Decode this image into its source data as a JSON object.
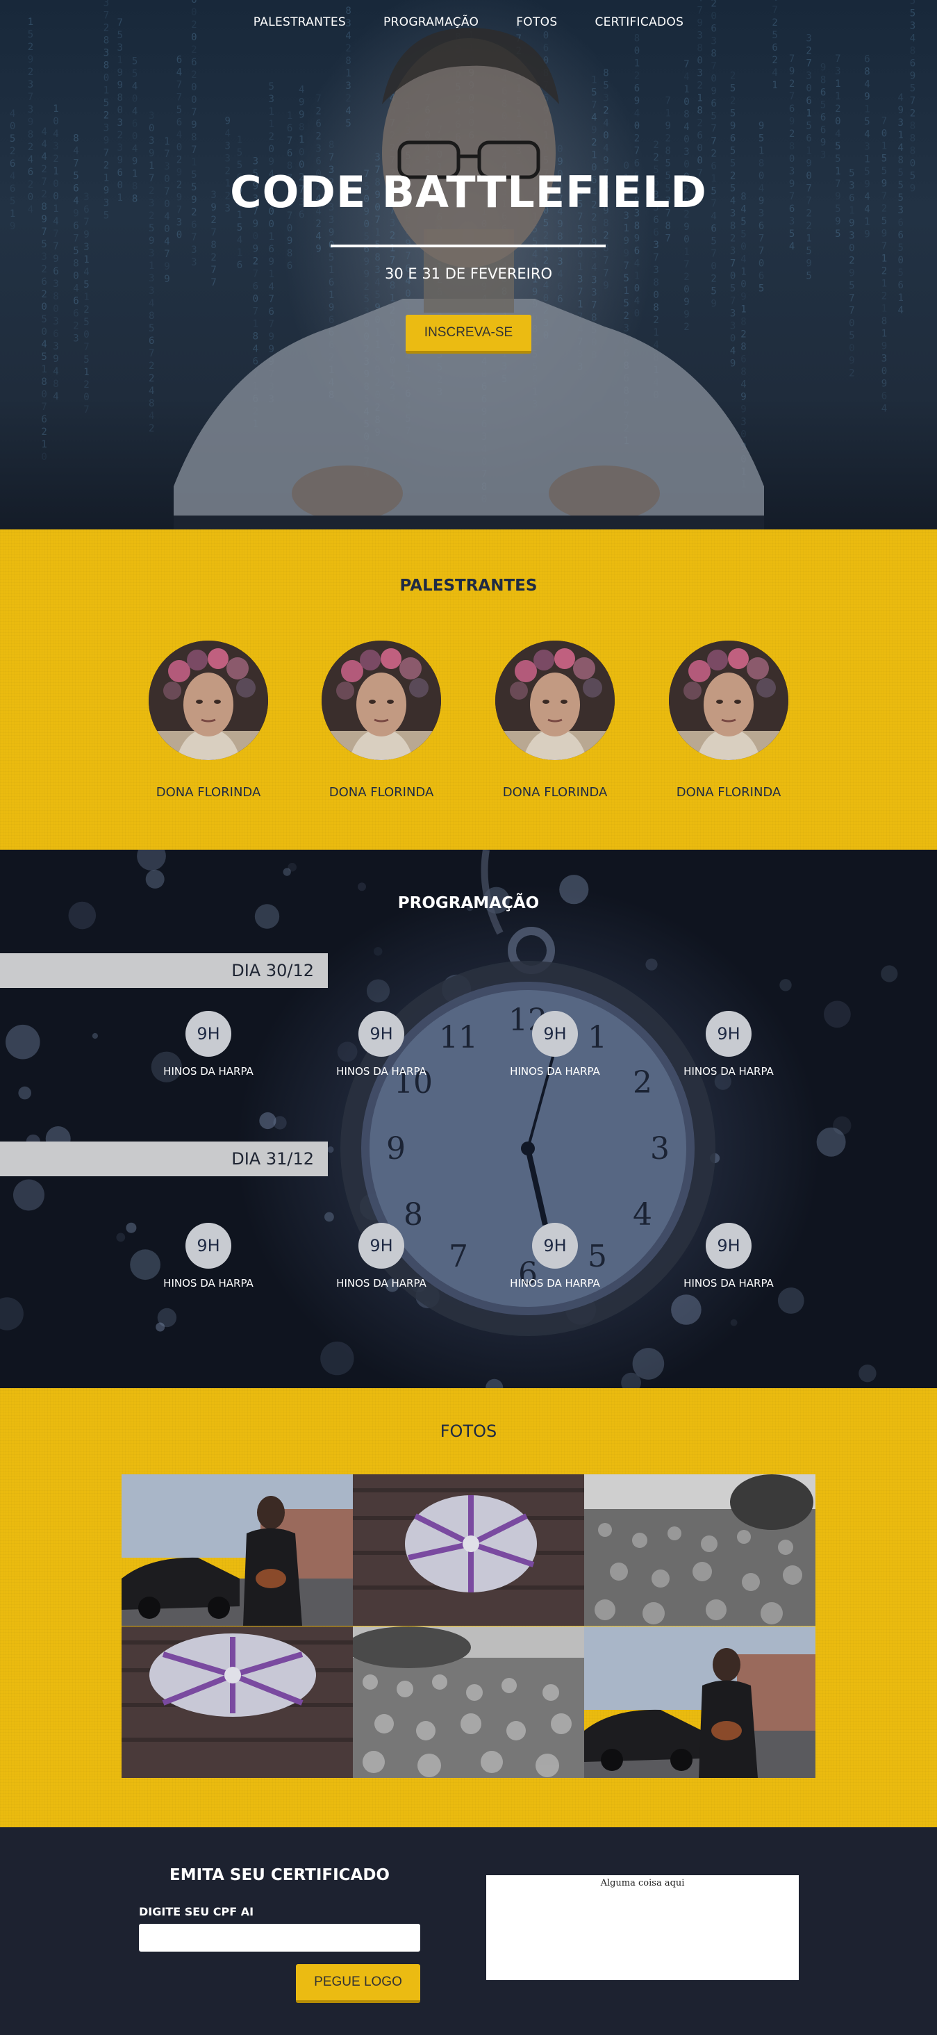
{
  "nav": {
    "items": [
      "PALESTRANTES",
      "PROGRAMAÇÃO",
      "FOTOS",
      "CERTIFICADOS"
    ]
  },
  "hero": {
    "title": "CODE BATTLEFIELD",
    "date": "30 E 31 DE FEVEREIRO",
    "cta_label": "INSCREVA-SE"
  },
  "speakers": {
    "title": "PALESTRANTES",
    "items": [
      {
        "name": "DONA FLORINDA"
      },
      {
        "name": "DONA FLORINDA"
      },
      {
        "name": "DONA FLORINDA"
      },
      {
        "name": "DONA FLORINDA"
      }
    ]
  },
  "schedule": {
    "title": "PROGRAMAÇÃO",
    "days": [
      {
        "label": "DIA 30/12",
        "slots": [
          {
            "hour": "9H",
            "talk": "HINOS DA HARPA"
          },
          {
            "hour": "9H",
            "talk": "HINOS DA HARPA"
          },
          {
            "hour": "9H",
            "talk": "HINOS DA HARPA"
          },
          {
            "hour": "9H",
            "talk": "HINOS DA HARPA"
          }
        ]
      },
      {
        "label": "DIA 31/12",
        "slots": [
          {
            "hour": "9H",
            "talk": "HINOS DA HARPA"
          },
          {
            "hour": "9H",
            "talk": "HINOS DA HARPA"
          },
          {
            "hour": "9H",
            "talk": "HINOS DA HARPA"
          },
          {
            "hour": "9H",
            "talk": "HINOS DA HARPA"
          }
        ]
      }
    ]
  },
  "photos": {
    "title": "FOTOS"
  },
  "certificate": {
    "title": "EMITA SEU CERTIFICADO",
    "cpf_label": "DIGITE SEU CPF AI",
    "cpf_value": "",
    "submit_label": "PEGUE LOGO",
    "output_text": "Alguma coisa aqui"
  },
  "colors": {
    "accent_yellow": "#ebbb0f",
    "navy": "#1d2230",
    "title_navy": "#1e2a44"
  }
}
